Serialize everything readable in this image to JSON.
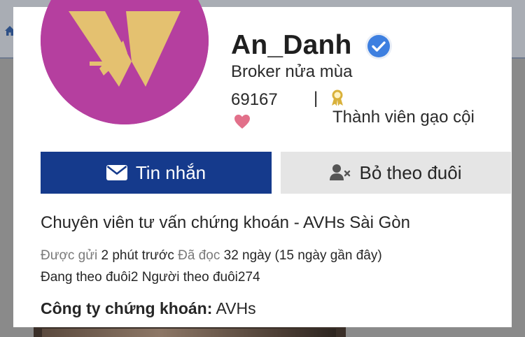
{
  "profile": {
    "username": "An_Danh",
    "title": "Broker nửa mùa",
    "count": "69167",
    "separator": "|",
    "rank": "Thành viên gạo cội",
    "bio": "Chuyên viên tư vấn chứng khoán - AVHs Sài Gòn"
  },
  "actions": {
    "message_label": "Tin nhắn",
    "unfollow_label": "Bỏ theo đuôi"
  },
  "meta": {
    "posted_label": "Được gửi",
    "posted_value": "2 phút trước",
    "read_label": "Đã đọc",
    "read_value": "32 ngày (15 ngày gần đây)",
    "following_label": "Đang theo đuôi",
    "following_count": "2",
    "followers_label": "Người theo đuôi",
    "followers_count": "274"
  },
  "company": {
    "label": "Công ty chứng khoán:",
    "value": "AVHs"
  },
  "icons": {
    "verified": "verified-check-icon",
    "heart": "heart-icon",
    "award": "award-ribbon-icon",
    "message": "envelope-icon",
    "unfollow": "user-remove-icon",
    "home": "home-icon"
  },
  "colors": {
    "primary_button": "#153a8c",
    "secondary_button": "#e5e5e5",
    "verified": "#3d7fe0",
    "heart": "#e2708a",
    "award": "#d9b13a",
    "avatar_bg": "#b53f9f",
    "avatar_logo": "#e4c170"
  }
}
